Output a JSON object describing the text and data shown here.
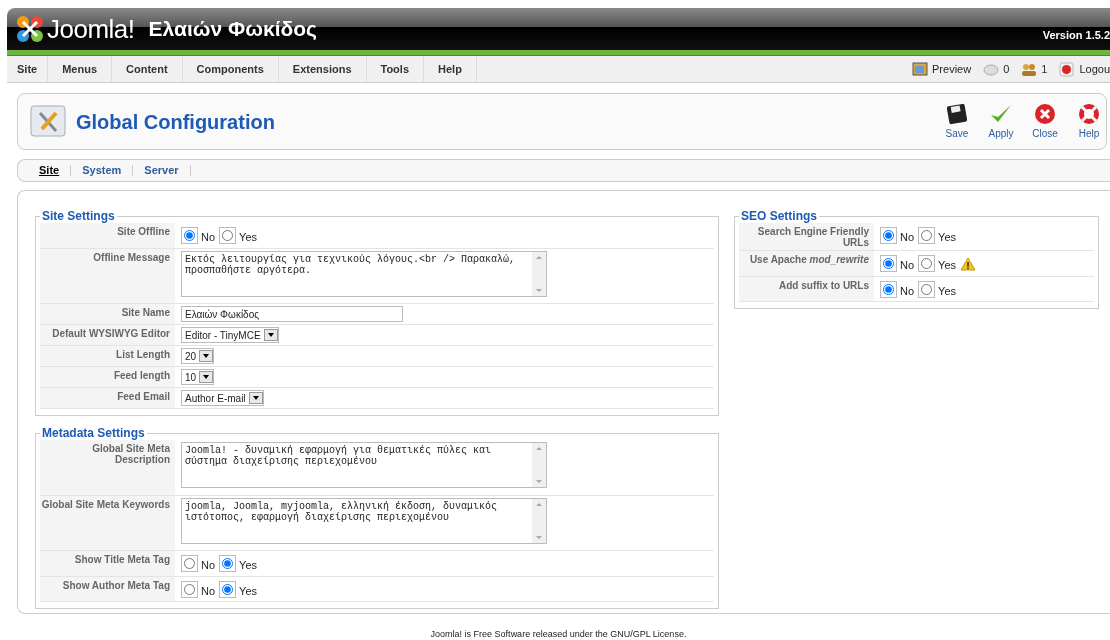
{
  "header": {
    "logo_text": "Joomla!",
    "site_title": "Ελαιών Φωκίδος",
    "version": "Version 1.5.2"
  },
  "menu": [
    {
      "label": "Site"
    },
    {
      "label": "Menus"
    },
    {
      "label": "Content"
    },
    {
      "label": "Components"
    },
    {
      "label": "Extensions"
    },
    {
      "label": "Tools"
    },
    {
      "label": "Help"
    }
  ],
  "status": [
    {
      "kind": "preview",
      "label": "Preview"
    },
    {
      "kind": "messages",
      "label": "0"
    },
    {
      "kind": "users",
      "label": "1"
    },
    {
      "kind": "logout",
      "label": "Logou"
    }
  ],
  "toolbar": {
    "title": "Global Configuration",
    "buttons": [
      {
        "kind": "save",
        "label": "Save"
      },
      {
        "kind": "apply",
        "label": "Apply"
      },
      {
        "kind": "close",
        "label": "Close"
      },
      {
        "kind": "help",
        "label": "Help"
      }
    ]
  },
  "tabs": [
    {
      "label": "Site",
      "selected": true
    },
    {
      "label": "System",
      "selected": false
    },
    {
      "label": "Server",
      "selected": false
    }
  ],
  "left_sections": [
    {
      "legend": "Site Settings",
      "rows": [
        {
          "label": "Site Offline",
          "kind": "radio",
          "options": [
            {
              "label": "No",
              "selected": true
            },
            {
              "label": "Yes",
              "selected": false
            }
          ]
        },
        {
          "label": "Offline Message",
          "kind": "textarea",
          "value": "Εκτός λειτουργίας για τεχνικούς λόγους.<br /> Παρακαλώ, προσπαθήστε αργότερα."
        },
        {
          "label": "Site Name",
          "kind": "text",
          "value": "Ελαιών Φωκίδος"
        },
        {
          "label": "Default WYSIWYG Editor",
          "kind": "select",
          "value": "Editor - TinyMCE"
        },
        {
          "label": "List Length",
          "kind": "select",
          "value": "20"
        },
        {
          "label": "Feed length",
          "kind": "select",
          "value": "10"
        },
        {
          "label": "Feed Email",
          "kind": "select",
          "value": "Author E-mail"
        }
      ]
    },
    {
      "legend": "Metadata Settings",
      "rows": [
        {
          "label": "Global Site Meta Description",
          "kind": "textarea",
          "value": "Joomla! - δυναμική εφαρμογή για θεματικές πύλες και σύστημα διαχείρισης περιεχομένου"
        },
        {
          "label": "Global Site Meta Keywords",
          "kind": "textarea",
          "value": "joomla, Joomla, myjoomla, ελληνική έκδοση, δυναμικός ιστότοπος, εφαρμογή διαχείρισης περιεχομένου"
        },
        {
          "label": "Show Title Meta Tag",
          "kind": "radio",
          "options": [
            {
              "label": "No",
              "selected": false
            },
            {
              "label": "Yes",
              "selected": true
            }
          ]
        },
        {
          "label": "Show Author Meta Tag",
          "kind": "radio",
          "options": [
            {
              "label": "No",
              "selected": false
            },
            {
              "label": "Yes",
              "selected": true
            }
          ]
        }
      ]
    }
  ],
  "right_sections": [
    {
      "legend": "SEO Settings",
      "rows": [
        {
          "label": "Search Engine Friendly URLs",
          "kind": "radio",
          "options": [
            {
              "label": "No",
              "selected": true
            },
            {
              "label": "Yes",
              "selected": false
            }
          ]
        },
        {
          "label": "Use Apache *mod_rewrite*",
          "kind": "radio",
          "warning": true,
          "options": [
            {
              "label": "No",
              "selected": true
            },
            {
              "label": "Yes",
              "selected": false
            }
          ]
        },
        {
          "label": "Add suffix to URLs",
          "kind": "radio",
          "options": [
            {
              "label": "No",
              "selected": true
            },
            {
              "label": "Yes",
              "selected": false
            }
          ]
        }
      ]
    }
  ],
  "footer": {
    "link": "Joomla!",
    "text": " is Free Software released under the ",
    "license_link": "GNU/GPL License",
    "end": "."
  }
}
